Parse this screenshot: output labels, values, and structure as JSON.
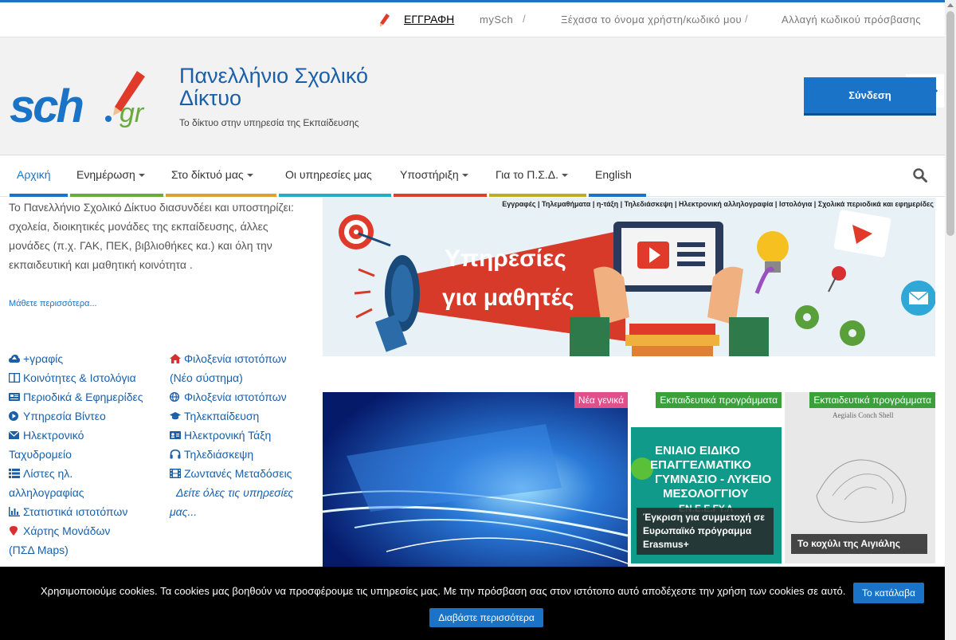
{
  "topbar": {
    "register": "ΕΓΓΡΑΦΗ",
    "mysch": "mySch",
    "forgot": "Ξέχασα το όνομα χρήστη/κωδικό μου",
    "change_password": "Αλλαγή κωδικού πρόσβασης",
    "separator": "/"
  },
  "header": {
    "logo_text": "sch.gr",
    "title": "Πανελλήνιο Σχολικό Δίκτυο",
    "subtitle": "Το δίκτυο στην υπηρεσία της Εκπαίδευσης",
    "login": "Σύνδεση"
  },
  "nav": {
    "items": [
      {
        "label": "Αρχική",
        "dropdown": false,
        "color": "#1a73c7"
      },
      {
        "label": "Ενημέρωση",
        "dropdown": true,
        "color": "#6aaa3a"
      },
      {
        "label": "Στο δίκτυό μας",
        "dropdown": true,
        "color": "#e0a030"
      },
      {
        "label": "Οι υπηρεσίες μας",
        "dropdown": false,
        "color": "#20b0c0"
      },
      {
        "label": "Υποστήριξη",
        "dropdown": true,
        "color": "#d84030"
      },
      {
        "label": "Για το Π.Σ.Δ.",
        "dropdown": true,
        "color": "#b8b020"
      },
      {
        "label": "English",
        "dropdown": false,
        "color": "#1a73c7"
      }
    ]
  },
  "intro": {
    "text": "Το Πανελλήνιο Σχολικό Δίκτυο διασυνδέει και υποστηρίζει: σχολεία, διοικητικές μονάδες της εκπαίδευσης,  άλλες μονάδες (π.χ. ΓΑΚ, ΠΕΚ, βιβλιοθήκες κα.) και όλη την εκπαιδευτική και μαθητική κοινότητα .",
    "more": "Μάθετε περισσότερα..."
  },
  "services_left": [
    {
      "label": "+γραφίς",
      "icon": "cloud-upload-icon"
    },
    {
      "label": "Κοινότητες & Ιστολόγια",
      "icon": "columns-icon"
    },
    {
      "label": "Περιοδικά & Εφημερίδες",
      "icon": "newspaper-icon"
    },
    {
      "label": "Υπηρεσία Βίντεο",
      "icon": "play-circle-icon"
    },
    {
      "label": "Ηλεκτρονικό",
      "icon": "envelope-icon"
    },
    {
      "label": "Ταχυδρομείο",
      "icon": ""
    },
    {
      "label": "Λίστες ηλ.",
      "icon": "list-icon"
    },
    {
      "label": "αλληλογραφίας",
      "icon": ""
    },
    {
      "label": "Στατιστικά ιστοτόπων",
      "icon": "bar-chart-icon"
    },
    {
      "label": "Χάρτης Μονάδων",
      "icon": "map-marker-icon"
    },
    {
      "label": "(ΠΣΔ Maps)",
      "icon": ""
    }
  ],
  "services_right": [
    {
      "label": "Φιλοξενία ιστοτόπων",
      "icon": "home-icon"
    },
    {
      "label": "(Νέο σύστημα)",
      "icon": ""
    },
    {
      "label": "Φιλοξενία ιστοτόπων",
      "icon": "globe-icon"
    },
    {
      "label": "Τηλεκπαίδευση",
      "icon": "graduation-cap-icon"
    },
    {
      "label": "Ηλεκτρονική Τάξη",
      "icon": "id-card-icon"
    },
    {
      "label": "Τηλεδιάσκεψη",
      "icon": "headphones-icon"
    },
    {
      "label": "Ζωντανές Μεταδόσεις",
      "icon": "film-icon"
    },
    {
      "label": "Δείτε όλες τις υπηρεσίες",
      "icon": ""
    },
    {
      "label": "μας...",
      "icon": ""
    }
  ],
  "banner": {
    "strip": "Εγγραφές | Τηλεμαθήματα | η-τάξη | Τηλεδιάσκεψη | Ηλεκτρονική αλληλογραφία | Ιστολόγια | Σχολικά περιοδικά και εφημερίδες",
    "line1": "Υπηρεσίες",
    "line2": "για μαθητές"
  },
  "tiles": [
    {
      "tag": "Νέα γενικά",
      "tag_color": "#e0508a",
      "caption": ""
    },
    {
      "tag": "Εκπαιδευτικά προγράμματα",
      "tag_color": "#3aa03a",
      "caption": "Έγκριση για συμμετοχή σε Ευρωπαϊκό πρόγραμμα Erasmus+",
      "image_text": [
        "ΕΝΙΑΙΟ ΕΙΔΙΚΟ",
        "ΕΠΑΓΓΕΛΜΑΤΙΚΟ",
        "ΓΥΜΝΑΣΙΟ - ΛΥΚΕΙΟ",
        "ΜΕΣΟΛΟΓΓΙΟΥ",
        "ΕΝ.Ε.Ε.ΓΥ.Λ"
      ]
    },
    {
      "tag": "Εκπαιδευτικά προγράμματα",
      "tag_color": "#3aa03a",
      "caption": "Το κοχύλι της Αιγιάλης",
      "image_text": "Aegialis Conch Shell"
    }
  ],
  "cookie": {
    "message": "Χρησιμοποιούμε cookies. Τα cookies μας βοηθούν να προσφέρουμε τις υπηρεσίες μας. Με την πρόσβαση σας στον ιστότοπο αυτό αποδέχεστε την χρήση των cookies σε αυτό.",
    "accept": "Το κατάλαβα",
    "read_more": "Διαβάστε περισσότερα"
  }
}
